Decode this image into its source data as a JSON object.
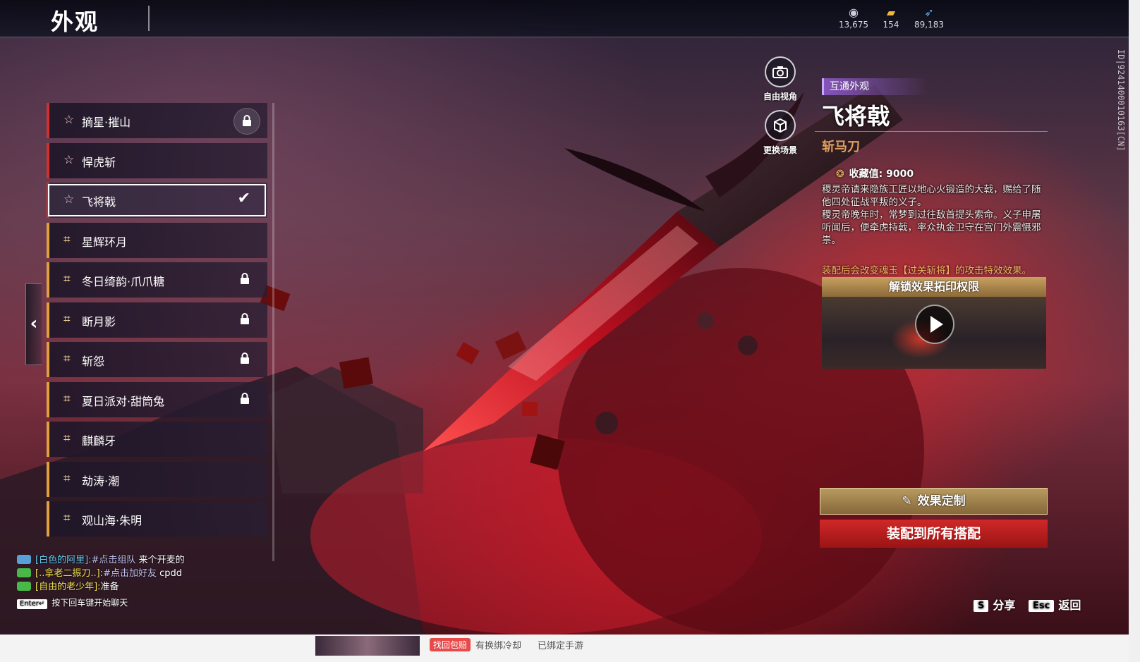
{
  "header": {
    "title": "外观",
    "currencies": [
      {
        "icon": "coin-icon",
        "value": "13,675"
      },
      {
        "icon": "gold-ticket-icon",
        "value": "154"
      },
      {
        "icon": "feather-icon",
        "value": "89,183"
      }
    ],
    "id_text": "ID|9241400010163[CN]"
  },
  "skins": [
    {
      "name": "摘星·摧山",
      "rarity": "red",
      "icon": "star-icon",
      "locked": true,
      "selected": false
    },
    {
      "name": "悍虎斩",
      "rarity": "red",
      "icon": "star-icon",
      "locked": false,
      "selected": false
    },
    {
      "name": "飞将戟",
      "rarity": "red",
      "icon": "star-icon",
      "locked": false,
      "selected": true
    },
    {
      "name": "星辉环月",
      "rarity": "gold",
      "icon": "corner-icon",
      "locked": false,
      "selected": false
    },
    {
      "name": "冬日绮韵·爪爪糖",
      "rarity": "gold",
      "icon": "corner-icon",
      "locked": true,
      "selected": false
    },
    {
      "name": "断月影",
      "rarity": "gold",
      "icon": "corner-icon",
      "locked": true,
      "selected": false
    },
    {
      "name": "斩怨",
      "rarity": "gold",
      "icon": "corner-icon",
      "locked": true,
      "selected": false
    },
    {
      "name": "夏日派对·甜筒兔",
      "rarity": "gold",
      "icon": "corner-icon",
      "locked": true,
      "selected": false
    },
    {
      "name": "麒麟牙",
      "rarity": "gold",
      "icon": "corner-icon",
      "locked": false,
      "selected": false
    },
    {
      "name": "劫涛·潮",
      "rarity": "gold",
      "icon": "corner-icon",
      "locked": false,
      "selected": false
    },
    {
      "name": "观山海·朱明",
      "rarity": "gold",
      "icon": "corner-icon",
      "locked": false,
      "selected": false
    }
  ],
  "camera": {
    "free_view_label": "自由视角",
    "change_scene_label": "更换场景"
  },
  "detail": {
    "tag": "互通外观",
    "name": "飞将戟",
    "weapon_type": "斩马刀",
    "collect_label": "收藏值:",
    "collect_value": "9000",
    "desc_1": "稷灵帝请来隐族工匠以地心火锻造的大戟，赐给了随他四处征战平叛的义子。",
    "desc_2": "稷灵帝晚年时，常梦到过往敌首提头索命。义子申屠听闻后，便牵虎持戟，率众执金卫守在宫门外震慑邪祟。",
    "equip_note": "装配后会改变魂玉【过关斩将】的攻击特效效果。",
    "unlock_label": "解锁效果拓印权限",
    "custom_button": "效果定制",
    "equip_button": "装配到所有搭配"
  },
  "chat": {
    "lines": [
      {
        "channel": "[白色的阿里]:",
        "hint": "#点击组队",
        "text": " 来个开麦的",
        "type": "team"
      },
      {
        "channel": "[..拿老二振刀..]:",
        "hint": "#点击加好友",
        "text": " cpdd",
        "type": "world"
      },
      {
        "channel": "[自由的老少年]:",
        "hint": "",
        "text": "准备",
        "type": "world"
      }
    ],
    "enter_key": "Enter↵",
    "enter_hint": "按下回车键开始聊天"
  },
  "hotkeys": {
    "share_key": "S",
    "share_label": "分享",
    "back_key": "Esc",
    "back_label": "返回"
  },
  "web": {
    "tag": "找回包赔",
    "text1": "有换绑冷却",
    "text2": "已绑定手游"
  }
}
